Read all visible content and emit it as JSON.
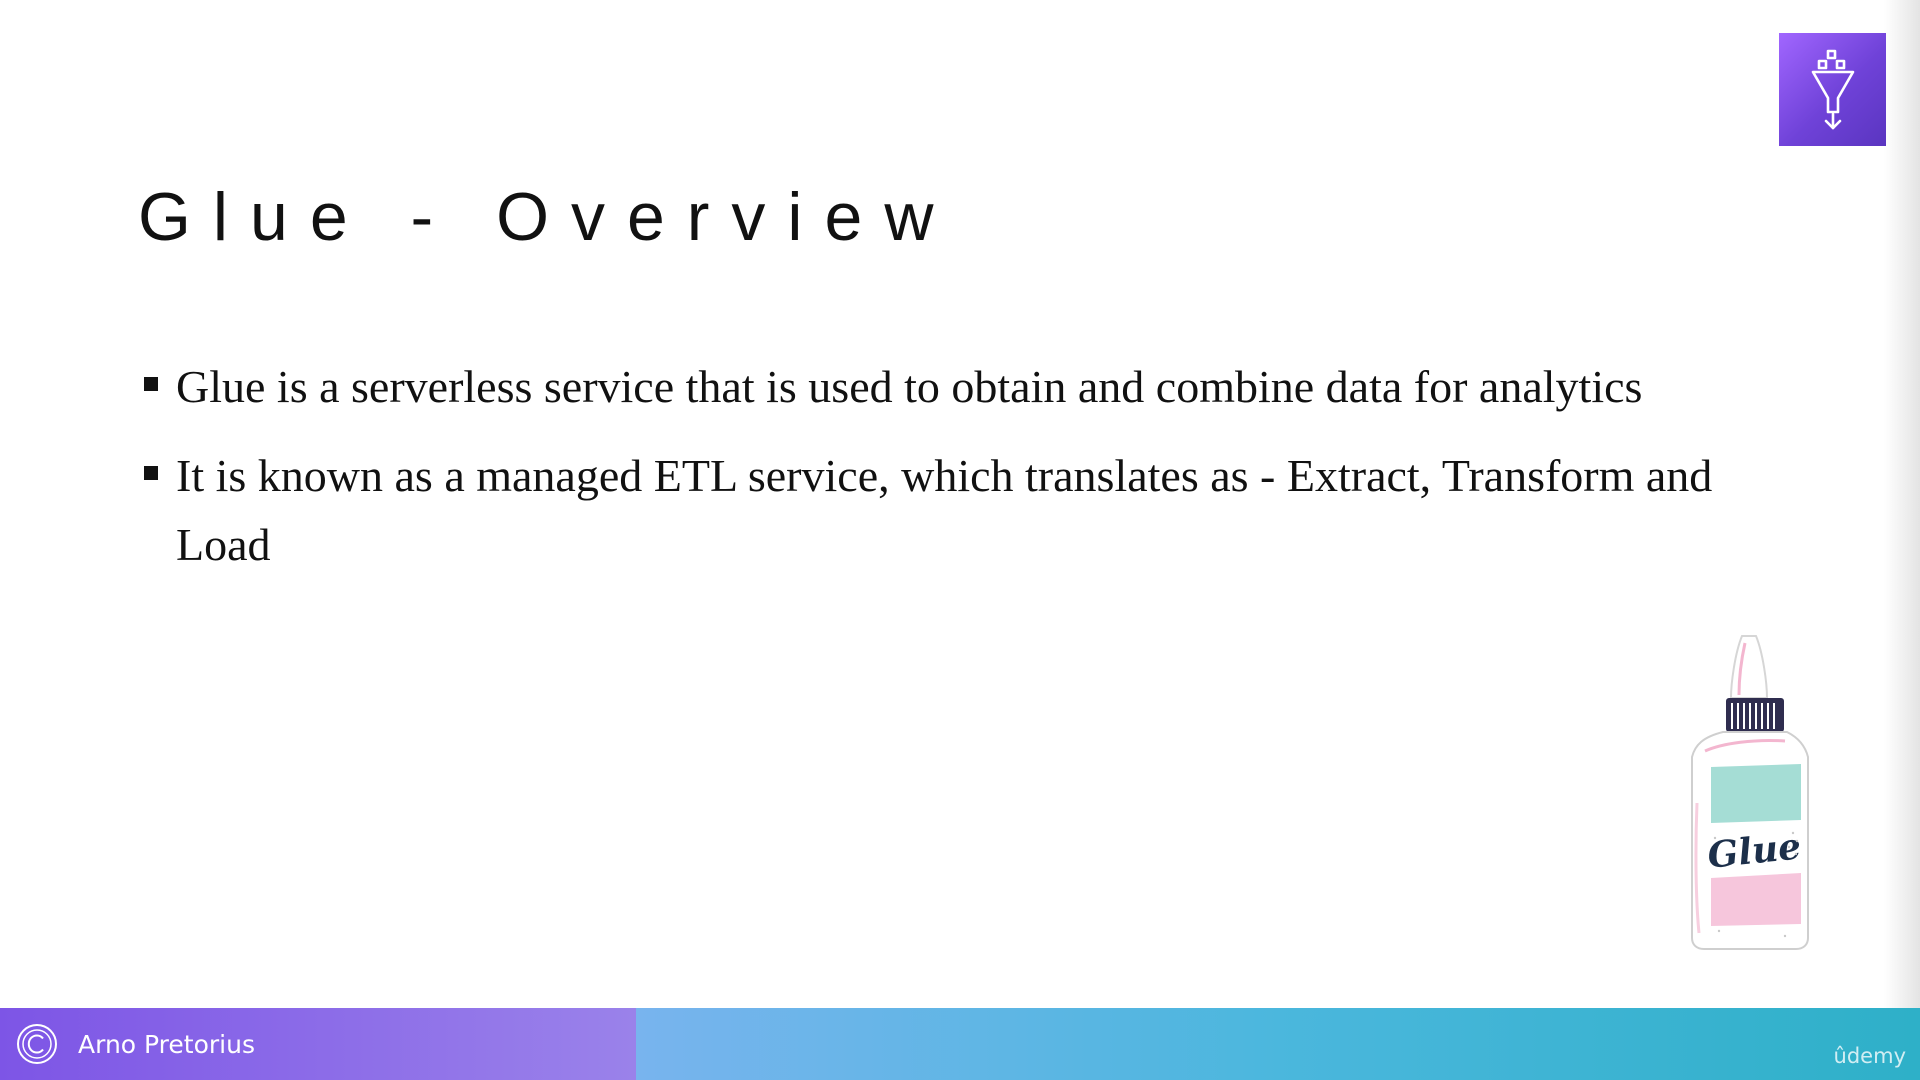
{
  "slide": {
    "title": "Glue - Overview",
    "bullets": [
      {
        "text": "Glue is a serverless service that is used to obtain and combine data for analytics"
      },
      {
        "text": "It is known as a managed ETL service, which translates as - Extract, Transform and Load"
      }
    ],
    "service_icon": "aws-glue-funnel-icon",
    "illustration": {
      "icon": "glue-bottle-illustration",
      "label": "Glue"
    }
  },
  "footer": {
    "author": "Arno Pretorius",
    "copyright_icon": "copyright-icon",
    "watermark": "ûdemy"
  },
  "colors": {
    "accent_purple": "#7d55e6",
    "service_icon_purple": "#6f42d8",
    "footer_teal": "#2eb0c8",
    "text": "#111111"
  }
}
